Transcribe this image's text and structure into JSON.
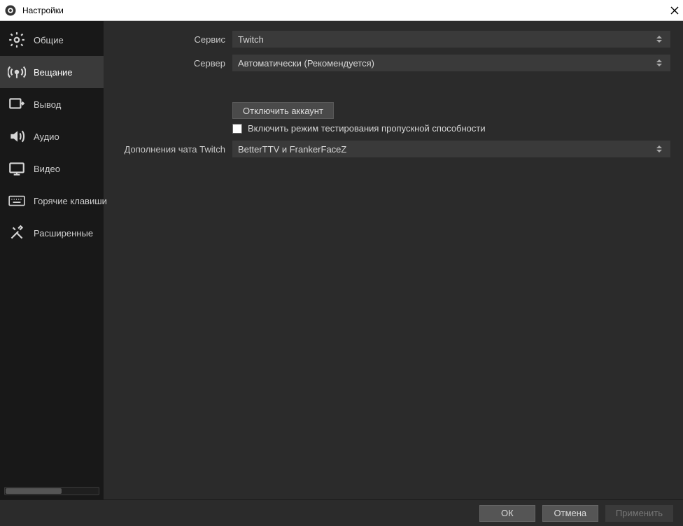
{
  "window": {
    "title": "Настройки"
  },
  "sidebar": {
    "items": [
      {
        "label": "Общие"
      },
      {
        "label": "Вещание"
      },
      {
        "label": "Вывод"
      },
      {
        "label": "Аудио"
      },
      {
        "label": "Видео"
      },
      {
        "label": "Горячие клавиши"
      },
      {
        "label": "Расширенные"
      }
    ],
    "active_index": 1
  },
  "form": {
    "service": {
      "label": "Сервис",
      "value": "Twitch"
    },
    "server": {
      "label": "Сервер",
      "value": "Автоматически (Рекомендуется)"
    },
    "disconnect_btn": "Отключить аккаунт",
    "bandwidth_test": {
      "label": "Включить режим тестирования пропускной способности",
      "checked": false
    },
    "twitch_addons": {
      "label": "Дополнения чата Twitch",
      "value": "BetterTTV и FrankerFaceZ"
    }
  },
  "footer": {
    "ok": "ОК",
    "cancel": "Отмена",
    "apply": "Применить"
  }
}
